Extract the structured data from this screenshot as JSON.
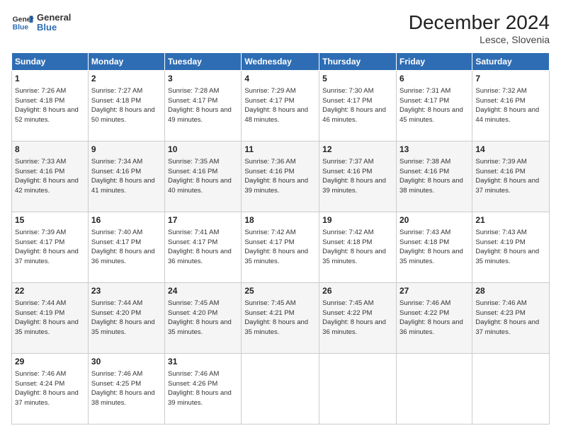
{
  "header": {
    "logo_line1": "General",
    "logo_line2": "Blue",
    "title": "December 2024",
    "subtitle": "Lesce, Slovenia"
  },
  "weekdays": [
    "Sunday",
    "Monday",
    "Tuesday",
    "Wednesday",
    "Thursday",
    "Friday",
    "Saturday"
  ],
  "weeks": [
    [
      {
        "day": "1",
        "sunrise": "7:26 AM",
        "sunset": "4:18 PM",
        "daylight": "8 hours and 52 minutes."
      },
      {
        "day": "2",
        "sunrise": "7:27 AM",
        "sunset": "4:18 PM",
        "daylight": "8 hours and 50 minutes."
      },
      {
        "day": "3",
        "sunrise": "7:28 AM",
        "sunset": "4:17 PM",
        "daylight": "8 hours and 49 minutes."
      },
      {
        "day": "4",
        "sunrise": "7:29 AM",
        "sunset": "4:17 PM",
        "daylight": "8 hours and 48 minutes."
      },
      {
        "day": "5",
        "sunrise": "7:30 AM",
        "sunset": "4:17 PM",
        "daylight": "8 hours and 46 minutes."
      },
      {
        "day": "6",
        "sunrise": "7:31 AM",
        "sunset": "4:17 PM",
        "daylight": "8 hours and 45 minutes."
      },
      {
        "day": "7",
        "sunrise": "7:32 AM",
        "sunset": "4:16 PM",
        "daylight": "8 hours and 44 minutes."
      }
    ],
    [
      {
        "day": "8",
        "sunrise": "7:33 AM",
        "sunset": "4:16 PM",
        "daylight": "8 hours and 42 minutes."
      },
      {
        "day": "9",
        "sunrise": "7:34 AM",
        "sunset": "4:16 PM",
        "daylight": "8 hours and 41 minutes."
      },
      {
        "day": "10",
        "sunrise": "7:35 AM",
        "sunset": "4:16 PM",
        "daylight": "8 hours and 40 minutes."
      },
      {
        "day": "11",
        "sunrise": "7:36 AM",
        "sunset": "4:16 PM",
        "daylight": "8 hours and 39 minutes."
      },
      {
        "day": "12",
        "sunrise": "7:37 AM",
        "sunset": "4:16 PM",
        "daylight": "8 hours and 39 minutes."
      },
      {
        "day": "13",
        "sunrise": "7:38 AM",
        "sunset": "4:16 PM",
        "daylight": "8 hours and 38 minutes."
      },
      {
        "day": "14",
        "sunrise": "7:39 AM",
        "sunset": "4:16 PM",
        "daylight": "8 hours and 37 minutes."
      }
    ],
    [
      {
        "day": "15",
        "sunrise": "7:39 AM",
        "sunset": "4:17 PM",
        "daylight": "8 hours and 37 minutes."
      },
      {
        "day": "16",
        "sunrise": "7:40 AM",
        "sunset": "4:17 PM",
        "daylight": "8 hours and 36 minutes."
      },
      {
        "day": "17",
        "sunrise": "7:41 AM",
        "sunset": "4:17 PM",
        "daylight": "8 hours and 36 minutes."
      },
      {
        "day": "18",
        "sunrise": "7:42 AM",
        "sunset": "4:17 PM",
        "daylight": "8 hours and 35 minutes."
      },
      {
        "day": "19",
        "sunrise": "7:42 AM",
        "sunset": "4:18 PM",
        "daylight": "8 hours and 35 minutes."
      },
      {
        "day": "20",
        "sunrise": "7:43 AM",
        "sunset": "4:18 PM",
        "daylight": "8 hours and 35 minutes."
      },
      {
        "day": "21",
        "sunrise": "7:43 AM",
        "sunset": "4:19 PM",
        "daylight": "8 hours and 35 minutes."
      }
    ],
    [
      {
        "day": "22",
        "sunrise": "7:44 AM",
        "sunset": "4:19 PM",
        "daylight": "8 hours and 35 minutes."
      },
      {
        "day": "23",
        "sunrise": "7:44 AM",
        "sunset": "4:20 PM",
        "daylight": "8 hours and 35 minutes."
      },
      {
        "day": "24",
        "sunrise": "7:45 AM",
        "sunset": "4:20 PM",
        "daylight": "8 hours and 35 minutes."
      },
      {
        "day": "25",
        "sunrise": "7:45 AM",
        "sunset": "4:21 PM",
        "daylight": "8 hours and 35 minutes."
      },
      {
        "day": "26",
        "sunrise": "7:45 AM",
        "sunset": "4:22 PM",
        "daylight": "8 hours and 36 minutes."
      },
      {
        "day": "27",
        "sunrise": "7:46 AM",
        "sunset": "4:22 PM",
        "daylight": "8 hours and 36 minutes."
      },
      {
        "day": "28",
        "sunrise": "7:46 AM",
        "sunset": "4:23 PM",
        "daylight": "8 hours and 37 minutes."
      }
    ],
    [
      {
        "day": "29",
        "sunrise": "7:46 AM",
        "sunset": "4:24 PM",
        "daylight": "8 hours and 37 minutes."
      },
      {
        "day": "30",
        "sunrise": "7:46 AM",
        "sunset": "4:25 PM",
        "daylight": "8 hours and 38 minutes."
      },
      {
        "day": "31",
        "sunrise": "7:46 AM",
        "sunset": "4:26 PM",
        "daylight": "8 hours and 39 minutes."
      },
      null,
      null,
      null,
      null
    ]
  ],
  "labels": {
    "sunrise": "Sunrise:",
    "sunset": "Sunset:",
    "daylight": "Daylight:"
  }
}
